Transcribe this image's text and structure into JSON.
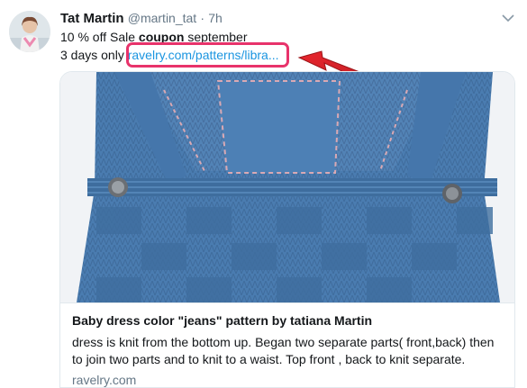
{
  "author": {
    "name": "Tat Martin",
    "handle": "@martin_tat",
    "separator": "·",
    "time": "7h"
  },
  "tweet": {
    "line1_prefix": "10 % off Sale ",
    "line1_bold": "coupon",
    "line1_suffix": " september",
    "line2_prefix": "3 days only ",
    "link_text": "ravelry.com/patterns/libra..."
  },
  "card": {
    "title": "Baby dress color \"jeans\" pattern by tatiana Martin",
    "description": "dress is knit from the bottom up. Began two separate parts( front,back) then to join two parts and to knit to a waist. Top front , back to knit separate.",
    "domain": "ravelry.com"
  },
  "colors": {
    "link": "#1b95e0",
    "highlight": "#e8336b",
    "arrow": "#e0262e",
    "knit": "#4a7cb0"
  },
  "icons": {
    "menu": "chevron-down-icon",
    "annotation": "red-arrow-icon"
  }
}
